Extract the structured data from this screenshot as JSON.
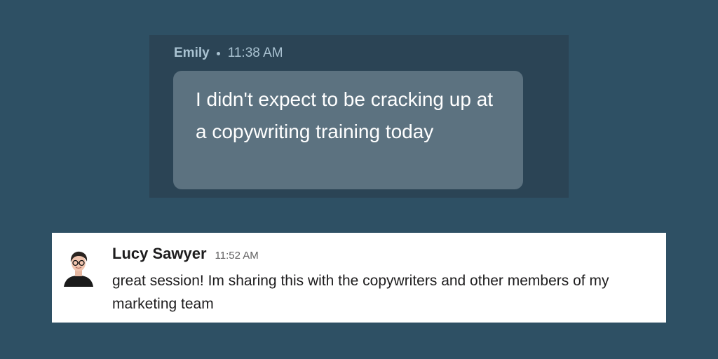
{
  "emily_message": {
    "sender": "Emily",
    "time": "11:38 AM",
    "text": "I didn't expect to be cracking up at a copywriting training today"
  },
  "lucy_message": {
    "sender": "Lucy Sawyer",
    "time": "11:52 AM",
    "text": "great session! Im sharing this with the copywriters and other members of my marketing team"
  },
  "colors": {
    "page_background": "#2e5064",
    "chat_card_background": "#2b4455",
    "bubble_background": "#5c7280",
    "header_text": "#a9c2d1",
    "message_card_background": "#ffffff"
  }
}
